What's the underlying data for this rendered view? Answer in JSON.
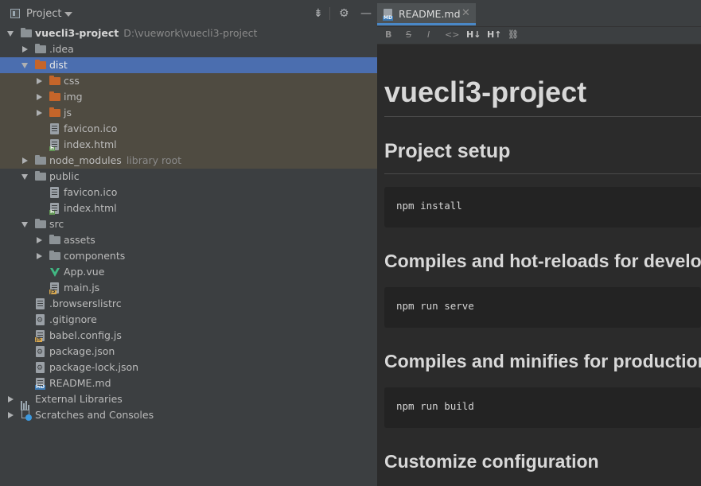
{
  "project_pane": {
    "title": "Project",
    "tools": {
      "collapse_icon": "collapse-all-icon",
      "gear_icon": "gear-icon",
      "hide_icon": "minimize-icon"
    }
  },
  "tree": {
    "root": {
      "name": "vuecli3-project",
      "path": "D:\\vuework\\vuecli3-project"
    },
    "idea": ".idea",
    "dist": "dist",
    "dist_css": "css",
    "dist_img": "img",
    "dist_js": "js",
    "dist_favicon": "favicon.ico",
    "dist_index": "index.html",
    "node_modules": "node_modules",
    "library_root": "library root",
    "public": "public",
    "public_favicon": "favicon.ico",
    "public_index": "index.html",
    "src": "src",
    "src_assets": "assets",
    "src_components": "components",
    "src_app": "App.vue",
    "src_main": "main.js",
    "browserslistrc": ".browserslistrc",
    "gitignore": ".gitignore",
    "babel_config": "babel.config.js",
    "package_json": "package.json",
    "package_lock": "package-lock.json",
    "readme": "README.md",
    "external_libraries": "External Libraries",
    "scratches": "Scratches and Consoles"
  },
  "editor": {
    "tab_label": "README.md",
    "toolbar": {
      "bold": "B",
      "strike": "S",
      "italic": "I",
      "code": "<>",
      "h_down": "H↓",
      "h_up": "H↑",
      "link": "🔗"
    }
  },
  "preview": {
    "title": "vuecli3-project",
    "h_setup": "Project setup",
    "code_install": "npm install",
    "h_dev": "Compiles and hot-reloads for development",
    "code_serve": "npm run serve",
    "h_prod": "Compiles and minifies for production",
    "code_build": "npm run build",
    "h_config": "Customize configuration"
  }
}
